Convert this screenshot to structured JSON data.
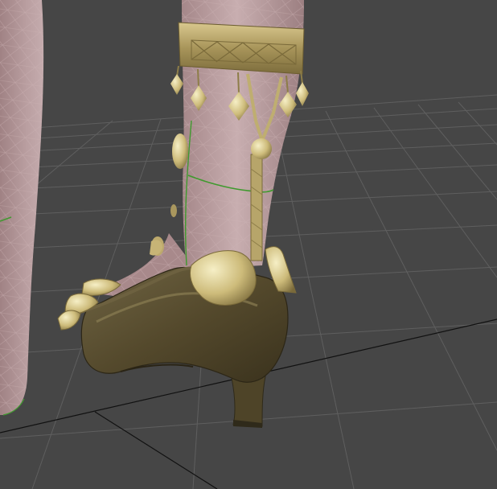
{
  "viewport": {
    "background_color": "#464646",
    "grid_line_color": "#5e5e5e",
    "grid_major_line_color": "#0f0f0f"
  },
  "model": {
    "skin_color": "#b59a9c",
    "wire_color": "#cfb7b9",
    "seam_color": "#3f9a2e",
    "gold_color": "#cdbb7a",
    "gold_dark_color": "#7a6a3a",
    "gold_light_color": "#f1e8b8",
    "shoe_color": "#5a5033",
    "shoe_dark_color": "#2f2a1a",
    "shoe_light_color": "#7b6f4a"
  }
}
